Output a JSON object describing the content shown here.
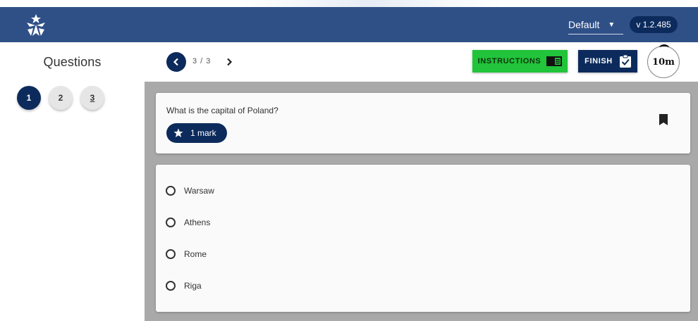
{
  "header": {
    "theme_value": "Default",
    "version": "v 1.2.485"
  },
  "sidebar": {
    "title": "Questions",
    "questions": [
      "1",
      "2",
      "3"
    ]
  },
  "toolbar": {
    "page_indicator": "3 / 3",
    "instructions_label": "INSTRUCTIONS",
    "finish_label": "FINISH",
    "timer_label": "10m"
  },
  "question": {
    "text": "What is the capital of Poland?",
    "marks_label": "1 mark",
    "options": [
      "Warsaw",
      "Athens",
      "Rome",
      "Riga"
    ]
  },
  "colors": {
    "appbar": "#2f5087",
    "navy": "#0c2b5c",
    "instructions_green": "#21c43a",
    "content_bg": "#a9a9a9"
  }
}
